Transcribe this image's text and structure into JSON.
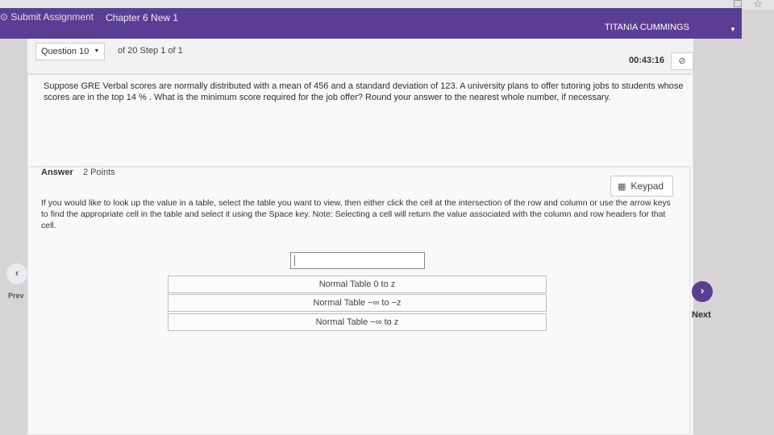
{
  "topbar": {
    "submit_label": "⊙ Submit Assignment",
    "chapter_title": "Chapter 6 New 1",
    "user_name": "TITANIA CUMMINGS",
    "caret_icon": "caret-down-icon"
  },
  "question_nav": {
    "question_select": "Question 10",
    "progress_text": "of 20 Step 1 of 1",
    "timer": "00:43:16",
    "hide_icon": "eye-slash-icon"
  },
  "question": {
    "text": "Suppose GRE Verbal scores are normally distributed with a mean of 456 and a standard deviation of 123. A university plans to offer tutoring jobs to students whose scores are in the top 14 % . What is the minimum score required for the job offer? Round your answer to the nearest whole number, if necessary."
  },
  "answer": {
    "label": "Answer",
    "points": "2 Points",
    "keypad_label": "Keypad",
    "instructions": "If you would like to look up the value in a table, select the table you want to view, then either click the cell at the intersection of the row and column or use the arrow keys to find the appropriate cell in the table and select it using the Space key. Note: Selecting a cell will return the value associated with the column and row headers for that cell.",
    "input_value": "",
    "tables": [
      "Normal Table 0 to z",
      "Normal Table −∞ to −z",
      "Normal Table −∞ to z"
    ]
  },
  "nav": {
    "prev_label": "Prev",
    "next_label": "Next",
    "prev_icon": "chevron-left-icon",
    "next_icon": "chevron-right-icon"
  },
  "colors": {
    "topbar": "#5a3e93",
    "panel": "#f4f3f5",
    "background": "#d6d4d7"
  }
}
